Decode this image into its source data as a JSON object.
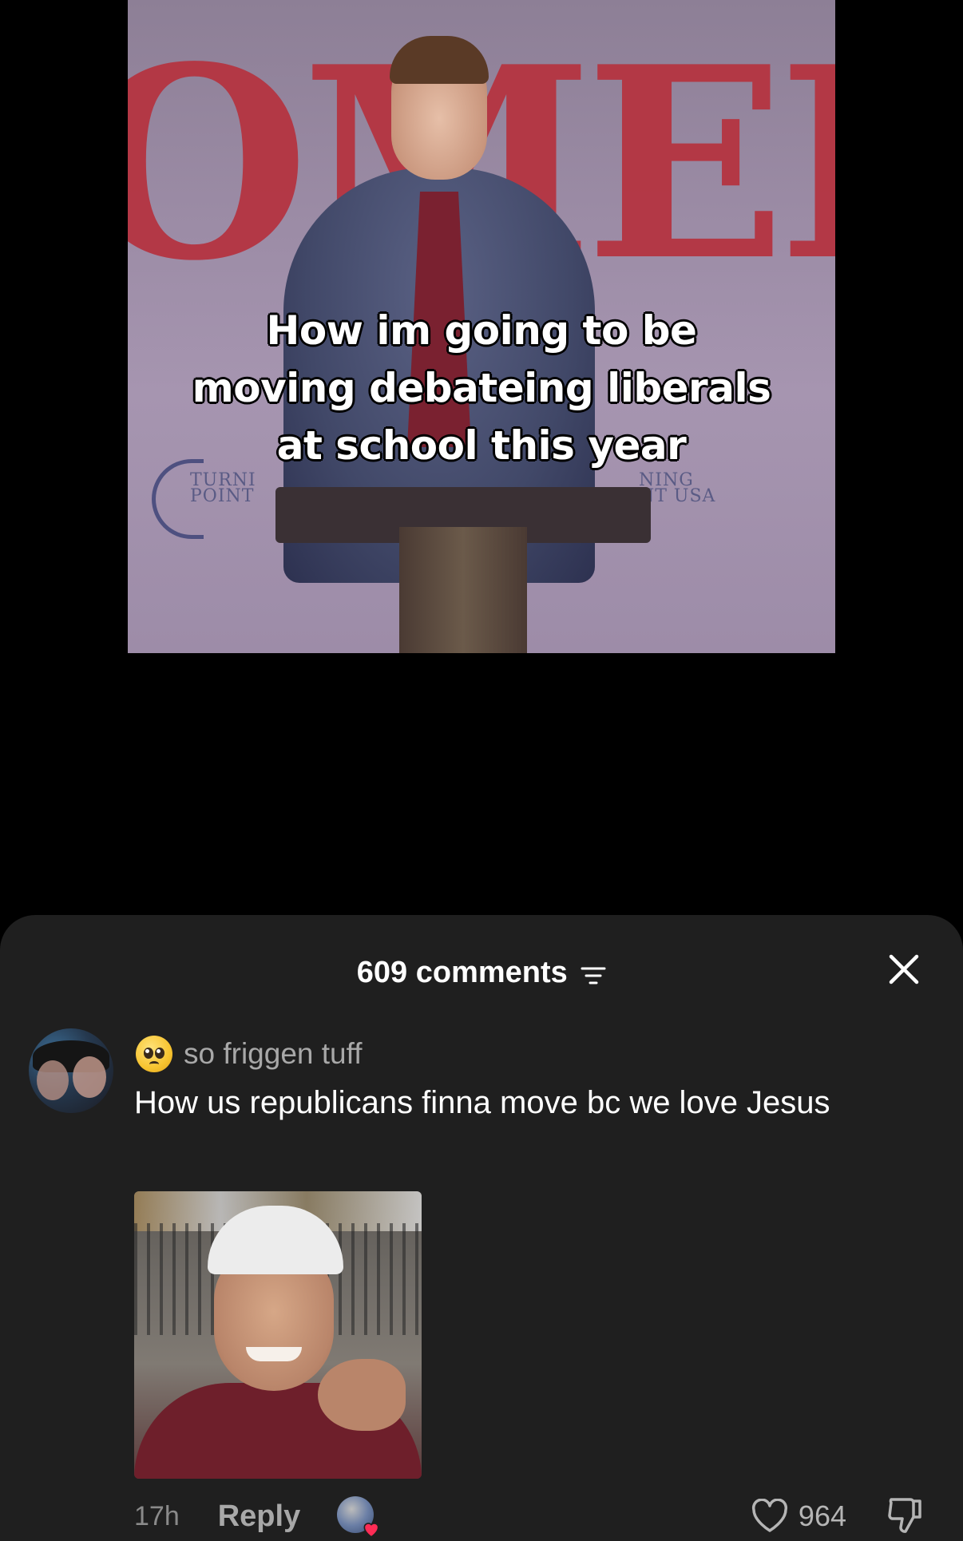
{
  "video": {
    "banner_text": "OMEBAC",
    "caption_lines": [
      "How im going to be",
      "moving debateing liberals",
      "at school this year"
    ],
    "logo_left": "TURNI\nPOINT",
    "logo_right": "NING\nNT USA"
  },
  "comments_sheet": {
    "count_label": "609 comments",
    "sort_icon": "filter-lines-icon",
    "close_icon": "close-x-icon"
  },
  "comment": {
    "username": "so friggen tuff",
    "username_emoji": "pleading-face-emoji",
    "text": "How us republicans finna move bc we love Jesus",
    "time": "17h",
    "reply_label": "Reply",
    "like_count": "964",
    "creator_liked": true
  },
  "colors": {
    "sheet_bg": "#1f1f1f",
    "banner_red": "#b53441",
    "heart_badge": "#fe2c55",
    "muted_text": "#a8a8a8"
  }
}
